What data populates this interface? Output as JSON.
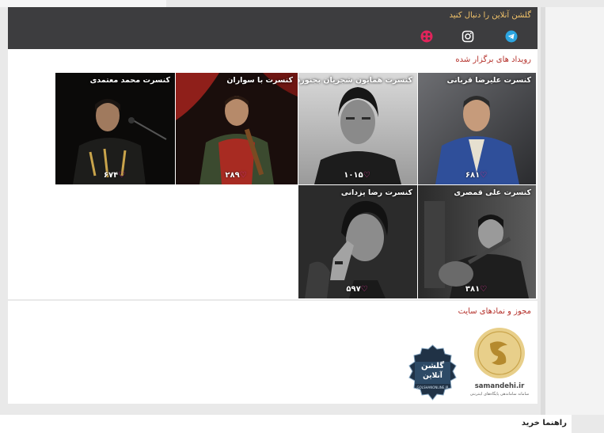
{
  "header": {
    "follow_text": "گلشن آنلاین را دنبال کنید",
    "social": [
      "telegram-icon",
      "instagram-icon",
      "aparat-icon"
    ]
  },
  "events": {
    "title": "رویداد های برگزار شده",
    "items": [
      {
        "title": "کنسرت علیرضا قربانی",
        "count": "۶۸۱"
      },
      {
        "title": "کنسرت همایون شجریان بجنورد",
        "count": "۱۰۱۵"
      },
      {
        "title": "کنسرت با سواران",
        "count": "۲۸۹"
      },
      {
        "title": "کنسرت محمد معتمدی",
        "count": "۶۷۴"
      },
      {
        "title": "کنسرت علی قمصری",
        "count": "۳۸۱"
      },
      {
        "title": "کنسرت رضا یزدانی",
        "count": "۵۹۷"
      }
    ]
  },
  "licenses": {
    "title": "مجوز و نمادهای سایت",
    "samandehi_domain": "samandehi.ir",
    "samandehi_caption": "سامانه ساماندهی پایگاه‌های اینترنتی",
    "logo_text_1": "گلشن",
    "logo_text_2": "آنلاین",
    "logo_url": "GOLSHANONLINE.IR"
  },
  "footer": {
    "guide_label": "راهنما خرید"
  },
  "colors": {
    "header_bg": "#3d3d3f",
    "follow_text": "#f2c36a",
    "section_title": "#b5322c",
    "heart": "#e83aa0"
  }
}
